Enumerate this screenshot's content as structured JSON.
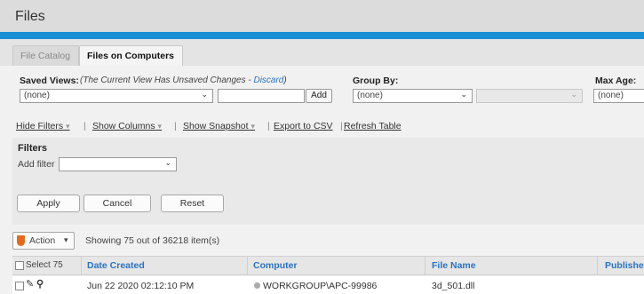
{
  "header": {
    "title": "Files"
  },
  "tabs": [
    {
      "label": "File Catalog",
      "active": false
    },
    {
      "label": "Files on Computers",
      "active": true
    }
  ],
  "saved_views": {
    "label": "Saved Views:",
    "unsaved_text": "(The Current View Has Unsaved Changes - ",
    "discard_label": "Discard",
    "unsaved_close": ")",
    "selected": "(none)",
    "add_label": "Add"
  },
  "group_by": {
    "label": "Group By:",
    "selected": "(none)"
  },
  "max_age": {
    "label": "Max Age:",
    "selected": "(none)"
  },
  "toolbar": {
    "hide_filters": "Hide Filters",
    "show_columns": "Show Columns",
    "show_snapshot": "Show Snapshot",
    "export_csv": "Export to CSV",
    "refresh_table": "Refresh Table"
  },
  "filters": {
    "heading": "Filters",
    "add_filter_label": "Add filter",
    "apply_label": "Apply",
    "cancel_label": "Cancel",
    "reset_label": "Reset"
  },
  "action": {
    "label": "Action"
  },
  "showing_text": "Showing 75 out of 36218 item(s)",
  "table": {
    "select_label": "Select 75",
    "columns": [
      "Date Created",
      "Computer",
      "File Name",
      "Publishe"
    ],
    "rows": [
      {
        "date_created": "Jun 22 2020 02:12:10 PM",
        "computer": "WORKGROUP\\APC-99986",
        "file_name": "3d_501.dll",
        "publisher": ""
      }
    ]
  },
  "colors": {
    "accent_blue": "#1a8fd6",
    "link_blue": "#2a73c5",
    "action_orange": "#e36a1f"
  }
}
